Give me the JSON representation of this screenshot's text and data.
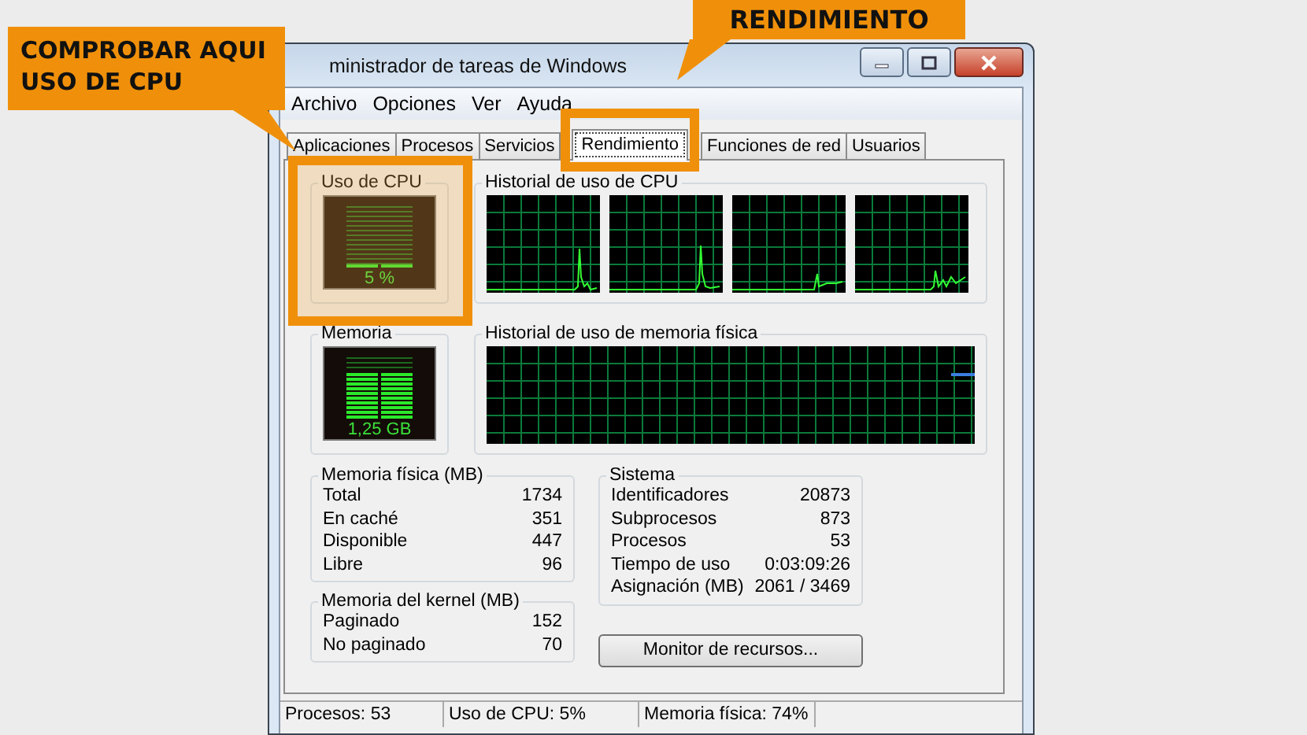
{
  "callouts": [
    {
      "text": "COMPROBAR AQUI USO DE CPU",
      "kind": "left"
    },
    {
      "text": "RENDIMIENTO",
      "kind": "top"
    }
  ],
  "window": {
    "title": "ministrador de tareas de Windows"
  },
  "menu": [
    "Archivo",
    "Opciones",
    "Ver",
    "Ayuda"
  ],
  "tabs": [
    {
      "label": "Aplicaciones",
      "selected": false
    },
    {
      "label": "Procesos",
      "selected": false
    },
    {
      "label": "Servicios",
      "selected": false
    },
    {
      "label": "Rendimiento",
      "selected": true
    },
    {
      "label": "Funciones de red",
      "selected": false
    },
    {
      "label": "Usuarios",
      "selected": false
    }
  ],
  "cpu_usage": {
    "title": "Uso de CPU",
    "reading": "5 %"
  },
  "cpu_history": {
    "title": "Historial de uso de CPU"
  },
  "memory": {
    "title": "Memoria",
    "reading": "1,25 GB"
  },
  "memory_history": {
    "title": "Historial de uso de memoria física"
  },
  "physical_memory": {
    "title": "Memoria física (MB)",
    "rows": [
      {
        "label": "Total",
        "value": "1734"
      },
      {
        "label": "En caché",
        "value": "351"
      },
      {
        "label": "Disponible",
        "value": "447"
      },
      {
        "label": "Libre",
        "value": "96"
      }
    ]
  },
  "kernel_memory": {
    "title": "Memoria del kernel (MB)",
    "rows": [
      {
        "label": "Paginado",
        "value": "152"
      },
      {
        "label": "No paginado",
        "value": "70"
      }
    ]
  },
  "system": {
    "title": "Sistema",
    "rows": [
      {
        "label": "Identificadores",
        "value": "20873"
      },
      {
        "label": "Subprocesos",
        "value": "873"
      },
      {
        "label": "Procesos",
        "value": "53"
      },
      {
        "label": "Tiempo de uso",
        "value": "0:03:09:26"
      },
      {
        "label": "Asignación (MB)",
        "value": "2061 / 3469"
      }
    ]
  },
  "resource_monitor_button": "Monitor de recursos...",
  "status_bar": [
    "Procesos: 53",
    "Uso de CPU: 5%",
    "Memoria física: 74%"
  ]
}
